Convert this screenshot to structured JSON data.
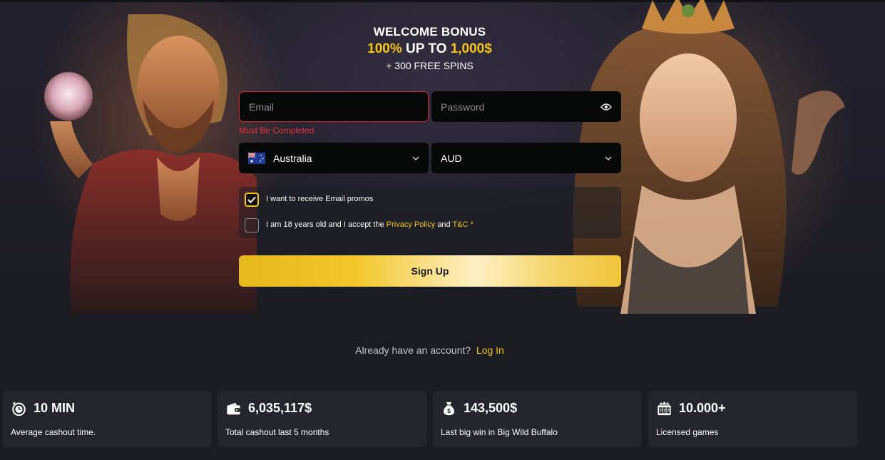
{
  "bonus": {
    "title": "WELCOME BONUS",
    "line2_percent": "100%",
    "line2_upto": "UP TO",
    "line2_amount": "1,000$",
    "line3": "+ 300 FREE SPINS"
  },
  "form": {
    "email_placeholder": "Email",
    "password_placeholder": "Password",
    "email_error": "Must Be Completed",
    "country_value": "Australia",
    "currency_value": "AUD",
    "promo_label": "I want to receive Email promos",
    "promo_checked": true,
    "terms_prefix": "I am 18 years old and I accept the",
    "terms_privacy": "Privacy Policy",
    "terms_and": "and",
    "terms_tc": "T&C",
    "terms_required": "*",
    "terms_checked": false,
    "signup_label": "Sign Up"
  },
  "login": {
    "prompt": "Already have an account?",
    "link": "Log In"
  },
  "stats": [
    {
      "icon": "stopwatch-icon",
      "value": "10 MIN",
      "label": "Average cashout time."
    },
    {
      "icon": "wallet-icon",
      "value": "6,035,117$",
      "label": "Total cashout last 5 months"
    },
    {
      "icon": "money-bag-icon",
      "value": "143,500$",
      "label": "Last big win in Big Wild Buffalo"
    },
    {
      "icon": "slot-machine-icon",
      "value": "10.000+",
      "label": "Licensed games"
    }
  ],
  "colors": {
    "background": "#1b1c22",
    "accent_gold": "#f5c518",
    "error_red": "#d6282d",
    "card": "#25262d"
  }
}
